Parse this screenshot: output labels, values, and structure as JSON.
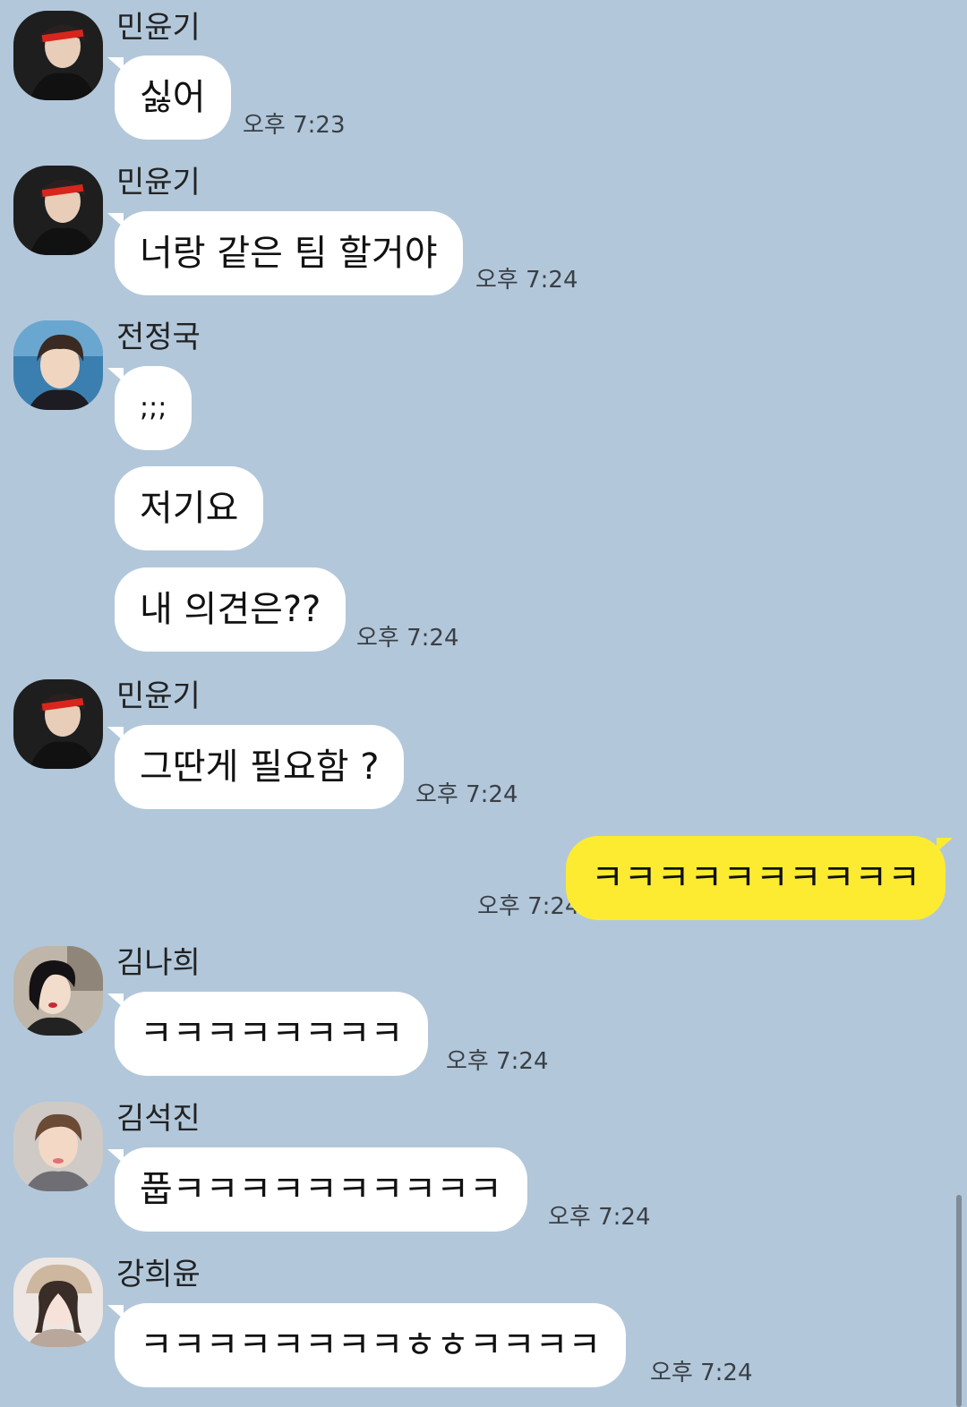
{
  "messages": [
    {
      "sender": "민윤기",
      "text": "싫어",
      "time": "오후 7:23"
    },
    {
      "sender": "민윤기",
      "text": "너랑 같은 팀 할거야",
      "time": "오후 7:24"
    },
    {
      "sender": "전정국",
      "text": ";;;"
    },
    {
      "text": "저기요"
    },
    {
      "text": "내 의견은??",
      "time": "오후 7:24"
    },
    {
      "sender": "민윤기",
      "text": "그딴게 필요함 ?",
      "time": "오후 7:24"
    },
    {
      "text": "ㅋㅋㅋㅋㅋㅋㅋㅋㅋㅋ",
      "time": "오후 7:24",
      "mine": true
    },
    {
      "sender": "김나희",
      "text": "ㅋㅋㅋㅋㅋㅋㅋㅋ",
      "time": "오후 7:24"
    },
    {
      "sender": "김석진",
      "text": "풉ㅋㅋㅋㅋㅋㅋㅋㅋㅋㅋ",
      "time": "오후 7:24"
    },
    {
      "sender": "강희윤",
      "text": "ㅋㅋㅋㅋㅋㅋㅋㅋㅎㅎㅋㅋㅋㅋ",
      "time": "오후 7:24"
    }
  ],
  "colors": {
    "background": "#b2c7da",
    "incoming_bubble": "#ffffff",
    "outgoing_bubble": "#fdeb32"
  }
}
